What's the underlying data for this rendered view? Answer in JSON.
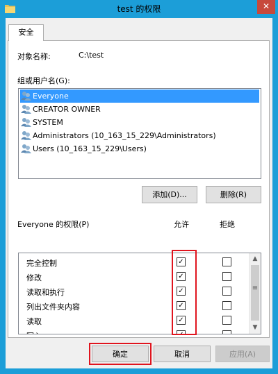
{
  "window": {
    "title": "test 的权限",
    "close_glyph": "✕"
  },
  "tabs": [
    {
      "label": "安全"
    }
  ],
  "object_name": {
    "label": "对象名称:",
    "value": "C:\\test"
  },
  "groups": {
    "label": "组或用户名(G):",
    "items": [
      {
        "name": "Everyone",
        "selected": true
      },
      {
        "name": "CREATOR OWNER",
        "selected": false
      },
      {
        "name": "SYSTEM",
        "selected": false
      },
      {
        "name": "Administrators (10_163_15_229\\Administrators)",
        "selected": false
      },
      {
        "name": "Users (10_163_15_229\\Users)",
        "selected": false
      }
    ],
    "add_button": "添加(D)...",
    "remove_button": "删除(R)"
  },
  "permissions": {
    "label": "Everyone 的权限(P)",
    "allow_header": "允许",
    "deny_header": "拒绝",
    "rows": [
      {
        "name": "完全控制",
        "allow": true,
        "deny": false
      },
      {
        "name": "修改",
        "allow": true,
        "deny": false
      },
      {
        "name": "读取和执行",
        "allow": true,
        "deny": false
      },
      {
        "name": "列出文件夹内容",
        "allow": true,
        "deny": false
      },
      {
        "name": "读取",
        "allow": true,
        "deny": false
      },
      {
        "name": "写入",
        "allow": true,
        "deny": false
      }
    ],
    "check_glyph": "✓"
  },
  "footer": {
    "ok_button": "确定",
    "cancel_button": "取消",
    "apply_button": "应用(A)"
  },
  "icons": {
    "folder": "folder-icon",
    "user_group": "user-group-icon"
  },
  "colors": {
    "titlebar": "#1c9ed8",
    "selection": "#3399ff",
    "highlight": "#e0141e",
    "close": "#c7493c"
  }
}
